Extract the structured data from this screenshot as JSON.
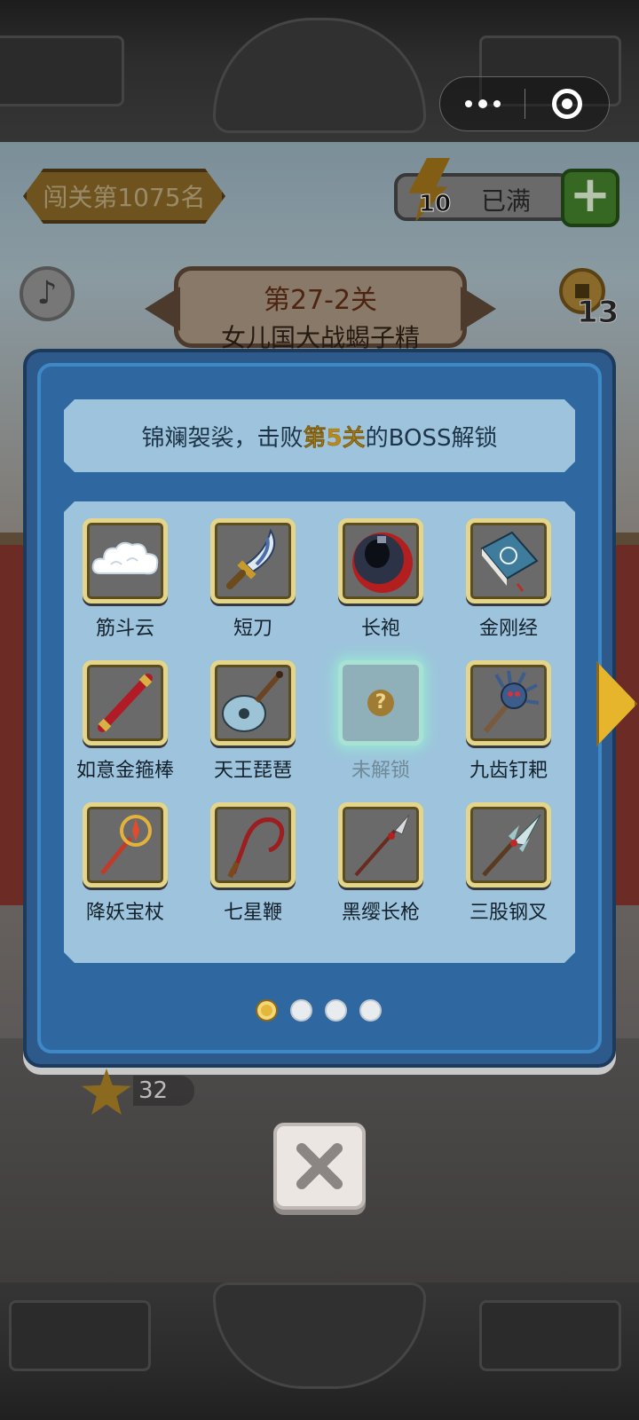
{
  "hud": {
    "rank_label": "闯关第1075名",
    "energy_count": "10",
    "energy_status": "已满",
    "energy_add": "+",
    "coin_count": "13",
    "star_count": "32"
  },
  "level": {
    "title": "第27-2关",
    "subtitle": "女儿国大战蝎子精"
  },
  "dialog": {
    "hint_prefix": "锦斓袈裟，击败",
    "hint_highlight": "第5关",
    "hint_suffix": "的BOSS解锁",
    "items": [
      {
        "label": "筋斗云",
        "icon": "cloud-icon",
        "locked": false
      },
      {
        "label": "短刀",
        "icon": "dagger-icon",
        "locked": false
      },
      {
        "label": "长袍",
        "icon": "robe-icon",
        "locked": false
      },
      {
        "label": "金刚经",
        "icon": "sutra-book-icon",
        "locked": false
      },
      {
        "label": "如意金箍棒",
        "icon": "golden-staff-icon",
        "locked": false
      },
      {
        "label": "天王琵琶",
        "icon": "pipa-lute-icon",
        "locked": false
      },
      {
        "label": "未解锁",
        "icon": "question-mark-icon",
        "locked": true
      },
      {
        "label": "九齿钉耙",
        "icon": "nine-tooth-rake-icon",
        "locked": false
      },
      {
        "label": "降妖宝杖",
        "icon": "demon-staff-icon",
        "locked": false
      },
      {
        "label": "七星鞭",
        "icon": "whip-icon",
        "locked": false
      },
      {
        "label": "黑缨长枪",
        "icon": "spear-icon",
        "locked": false
      },
      {
        "label": "三股钢叉",
        "icon": "trident-icon",
        "locked": false
      }
    ],
    "pager": {
      "total": 4,
      "active": 1
    }
  },
  "colors": {
    "dialog_bg": "#2d5a8a",
    "panel_bg": "#9dc4dc",
    "highlight": "#b8891a",
    "frame_gold": "#e4d58a"
  }
}
